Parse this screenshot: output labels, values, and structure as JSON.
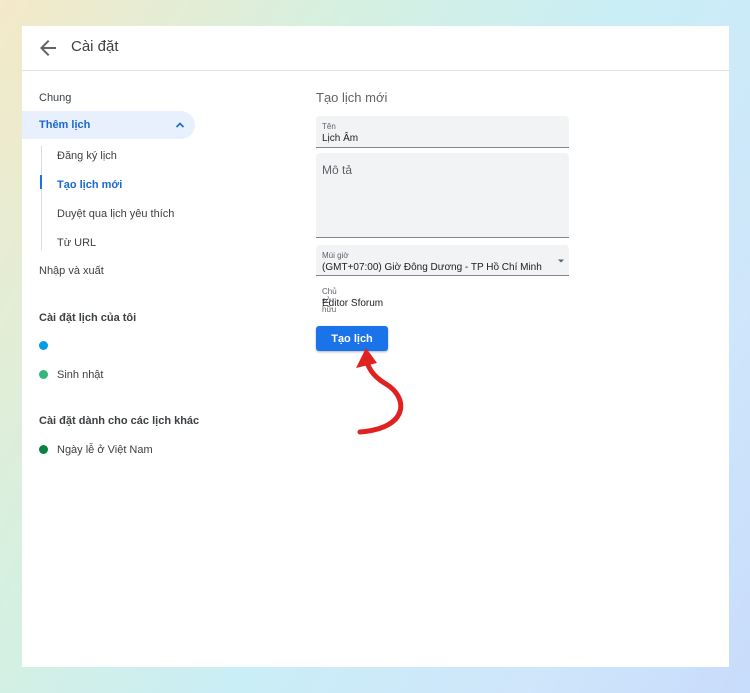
{
  "header": {
    "title": "Cài đặt"
  },
  "sidebar": {
    "general": "Chung",
    "add_calendar": "Thêm lịch",
    "sub_items": [
      "Đăng ký lịch",
      "Tạo lịch mới",
      "Duyệt qua lịch yêu thích",
      "Từ URL"
    ],
    "import_export": "Nhập và xuất",
    "my_calendars_heading": "Cài đặt lịch của tôi",
    "my_calendars": [
      {
        "label": "",
        "color": "#039be5"
      },
      {
        "label": "Sinh nhật",
        "color": "#33b679"
      }
    ],
    "other_calendars_heading": "Cài đặt dành cho các lịch khác",
    "other_calendars": [
      {
        "label": "Ngày lễ ở Việt Nam",
        "color": "#0b8043"
      }
    ]
  },
  "main": {
    "title": "Tạo lịch mới",
    "name_label": "Tên",
    "name_value": "Lịch Âm",
    "description_placeholder": "Mô tả",
    "timezone_label": "Múi giờ",
    "timezone_value": "(GMT+07:00) Giờ Đông Dương - TP Hồ Chí Minh",
    "owner_label": "Chủ sở hữu",
    "owner_value": "Editor Sforum",
    "create_button": "Tạo lịch"
  },
  "colors": {
    "accent": "#1a73e8",
    "annotation": "#e0211f"
  }
}
